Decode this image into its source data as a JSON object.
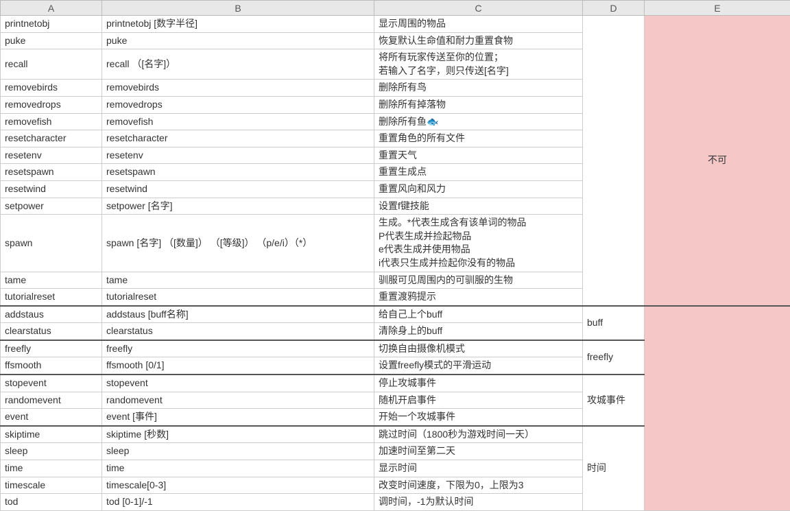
{
  "headers": {
    "A": "A",
    "B": "B",
    "C": "C",
    "D": "D",
    "E": "E"
  },
  "rows": [
    {
      "a": "printnetobj",
      "b": "printnetobj [数字半径]",
      "c": "显示周围的物品"
    },
    {
      "a": "puke",
      "b": "puke",
      "c": "恢复默认生命值和耐力重置食物"
    },
    {
      "a": "recall",
      "b": "recall  （[名字]）",
      "c": "将所有玩家传送至你的位置；\n若输入了名字，则只传送[名字]"
    },
    {
      "a": "removebirds",
      "b": "removebirds",
      "c": "删除所有鸟"
    },
    {
      "a": "removedrops",
      "b": "removedrops",
      "c": "删除所有掉落物"
    },
    {
      "a": "removefish",
      "b": "removefish",
      "c": "删除所有鱼🐟"
    },
    {
      "a": "resetcharacter",
      "b": "resetcharacter",
      "c": "重置角色的所有文件"
    },
    {
      "a": "resetenv",
      "b": "resetenv",
      "c": "重置天气"
    },
    {
      "a": "resetspawn",
      "b": "resetspawn",
      "c": "重置生成点"
    },
    {
      "a": "resetwind",
      "b": "resetwind",
      "c": "重置风向和风力"
    },
    {
      "a": "setpower",
      "b": "setpower [名字]",
      "c": "设置f键技能"
    },
    {
      "a": "spawn",
      "b": "spawn [名字]  （[数量]）  （[等级]）  （p/e/i）（*）",
      "c": "生成。*代表生成含有该单词的物品\nP代表生成并捡起物品\ne代表生成并使用物品\ni代表只生成并捡起你没有的物品"
    },
    {
      "a": "tame",
      "b": "tame",
      "c": "驯服可见周围内的可驯服的生物"
    },
    {
      "a": "tutorialreset",
      "b": "tutorialreset",
      "c": "重置渡鸦提示"
    },
    {
      "a": "addstaus",
      "b": "addstaus [buff名称]",
      "c": "给自己上个buff"
    },
    {
      "a": "clearstatus",
      "b": "clearstatus",
      "c": "清除身上的buff"
    },
    {
      "a": "freefly",
      "b": "freefly",
      "c": "切换自由摄像机模式"
    },
    {
      "a": "ffsmooth",
      "b": "ffsmooth [0/1]",
      "c": "设置freefly模式的平滑运动"
    },
    {
      "a": "stopevent",
      "b": "stopevent",
      "c": "停止攻城事件"
    },
    {
      "a": "randomevent",
      "b": "randomevent",
      "c": "随机开启事件"
    },
    {
      "a": "event",
      "b": "event [事件]",
      "c": "开始一个攻城事件"
    },
    {
      "a": "skiptime",
      "b": "skiptime [秒数]",
      "c": "跳过时间（1800秒为游戏时间一天）"
    },
    {
      "a": "sleep",
      "b": "sleep",
      "c": "加速时间至第二天"
    },
    {
      "a": "time",
      "b": "time",
      "c": "显示时间"
    },
    {
      "a": "timescale",
      "b": "timescale[0-3]",
      "c": "改变时间速度，下限为0，上限为3"
    },
    {
      "a": "tod",
      "b": "tod [0-1]/-1",
      "c": "调时间，-1为默认时间"
    }
  ],
  "groupD": {
    "buff": "buff",
    "freefly": "freefly",
    "siege": "攻城事件",
    "time": "时间"
  },
  "colE": "不可"
}
